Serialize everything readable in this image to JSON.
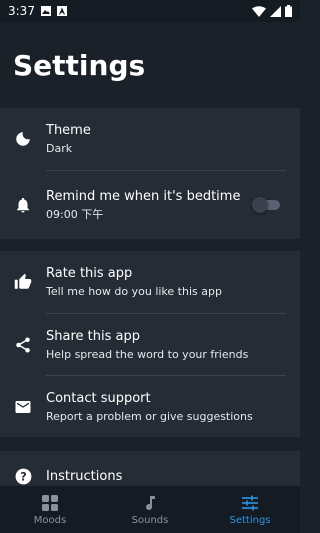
{
  "status": {
    "time": "3:37"
  },
  "header": {
    "title": "Settings"
  },
  "settings": {
    "theme": {
      "title": "Theme",
      "value": "Dark",
      "icon": "moon-icon"
    },
    "bedtime": {
      "title": "Remind me when it's bedtime",
      "value": "09:00 下午",
      "enabled": false,
      "icon": "bell-icon"
    },
    "rate": {
      "title": "Rate this app",
      "subtitle": "Tell me how do you like this app",
      "icon": "thumb-up-icon"
    },
    "share": {
      "title": "Share this app",
      "subtitle": "Help spread the word to your friends",
      "icon": "share-icon"
    },
    "contact": {
      "title": "Contact support",
      "subtitle": "Report a problem or give suggestions",
      "icon": "mail-icon"
    },
    "instructions": {
      "title": "Instructions",
      "icon": "help-icon"
    }
  },
  "bottom_nav": {
    "items": [
      {
        "label": "Moods",
        "icon": "grid-icon",
        "active": false
      },
      {
        "label": "Sounds",
        "icon": "music-note-icon",
        "active": false
      },
      {
        "label": "Settings",
        "icon": "sliders-icon",
        "active": true
      }
    ]
  },
  "colors": {
    "background": "#1b2129",
    "card": "#252c36",
    "accent": "#2d95e6",
    "nav_background": "#151b22"
  }
}
